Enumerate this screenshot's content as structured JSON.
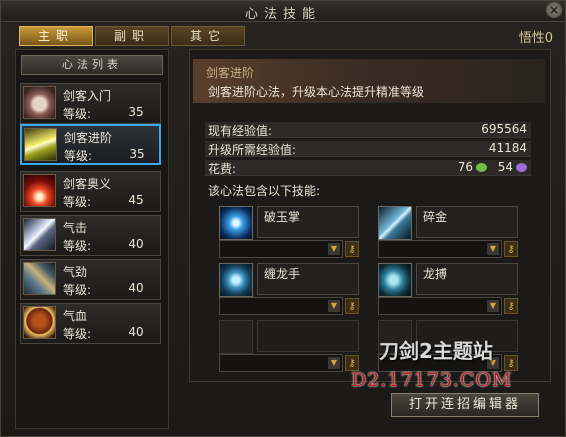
{
  "window": {
    "title": "心法技能",
    "close_label": "×"
  },
  "tabs": [
    {
      "label": "主职",
      "active": true
    },
    {
      "label": "副职",
      "active": false
    },
    {
      "label": "其它",
      "active": false
    }
  ],
  "wuxing": "悟性0",
  "list": {
    "header": "心法列表",
    "level_label": "等级:",
    "items": [
      {
        "name": "剑客入门",
        "level": "35",
        "icon": "fist-icon"
      },
      {
        "name": "剑客进阶",
        "level": "35",
        "icon": "sword-beam-icon",
        "selected": true
      },
      {
        "name": "剑客奥义",
        "level": "45",
        "icon": "burst-icon"
      },
      {
        "name": "气击",
        "level": "40",
        "icon": "blade-strike-icon"
      },
      {
        "name": "气劲",
        "level": "40",
        "icon": "hammer-icon"
      },
      {
        "name": "气血",
        "level": "40",
        "icon": "warrior-face-icon"
      }
    ]
  },
  "detail": {
    "name": "剑客进阶",
    "description": "剑客进阶心法，升级本心法提升精准等级",
    "exp_label": "现有经验值:",
    "exp_value": "695564",
    "need_label": "升级所需经验值:",
    "need_value": "41184",
    "cost_label": "花费:",
    "cost_green": "76",
    "cost_purple": "54",
    "contains_label": "该心法包含以下技能:",
    "skills": [
      {
        "name": "破玉掌",
        "icon": "palm-icon"
      },
      {
        "name": "碎金",
        "icon": "cross-blades-icon"
      },
      {
        "name": "缠龙手",
        "icon": "whirl-icon"
      },
      {
        "name": "龙搏",
        "icon": "dragon-icon"
      },
      {
        "name": "",
        "icon": "empty-slot-icon"
      },
      {
        "name": "",
        "icon": "empty-slot-icon"
      }
    ]
  },
  "watermark": {
    "line1": "刀剑2主题站",
    "line2": "D2.17173.COM"
  },
  "editor_button": "打开连招编辑器",
  "colors": {
    "selected_border": "#3aa9e8",
    "gem_green": "#6ec04a",
    "gem_purple": "#9a6fd8"
  }
}
